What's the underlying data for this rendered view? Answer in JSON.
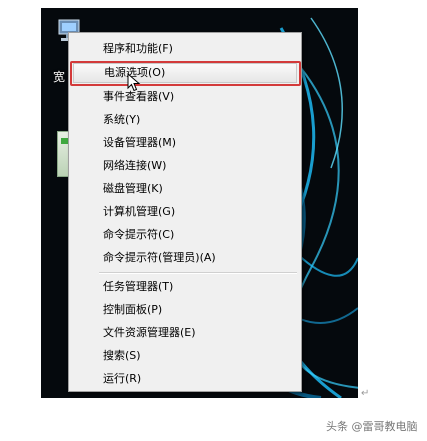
{
  "desktop": {
    "icon_label": "宽",
    "icons": [
      "network-icon",
      "app-icon"
    ]
  },
  "context_menu": {
    "items": [
      {
        "label": "程序和功能(F)"
      },
      {
        "label": "电源选项(O)",
        "highlighted": true
      },
      {
        "label": "事件查看器(V)"
      },
      {
        "label": "系统(Y)"
      },
      {
        "label": "设备管理器(M)"
      },
      {
        "label": "网络连接(W)"
      },
      {
        "label": "磁盘管理(K)"
      },
      {
        "label": "计算机管理(G)"
      },
      {
        "label": "命令提示符(C)"
      },
      {
        "label": "命令提示符(管理员)(A)"
      },
      {
        "label": "任务管理器(T)"
      },
      {
        "label": "控制面板(P)"
      },
      {
        "label": "文件资源管理器(E)"
      },
      {
        "label": "搜索(S)"
      },
      {
        "label": "运行(R)"
      }
    ]
  },
  "return_mark": "↵",
  "watermark": "头条 @雷哥教电脑",
  "colors": {
    "highlight_border": "#d33a3a",
    "menu_background": "#f0f0f0",
    "desktop_background": "#05090d",
    "streak": "#1ec3ff"
  }
}
